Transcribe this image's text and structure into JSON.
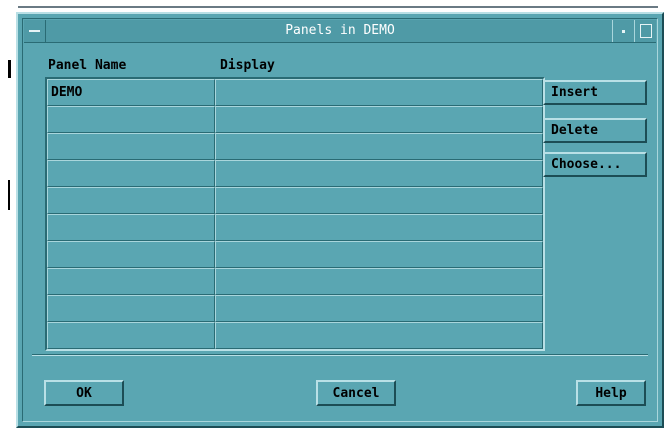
{
  "window": {
    "title": "Panels in DEMO"
  },
  "columns": {
    "name": "Panel Name",
    "display": "Display"
  },
  "rows": [
    {
      "name": "DEMO",
      "display": ""
    },
    {
      "name": "",
      "display": ""
    },
    {
      "name": "",
      "display": ""
    },
    {
      "name": "",
      "display": ""
    },
    {
      "name": "",
      "display": ""
    },
    {
      "name": "",
      "display": ""
    },
    {
      "name": "",
      "display": ""
    },
    {
      "name": "",
      "display": ""
    },
    {
      "name": "",
      "display": ""
    },
    {
      "name": "",
      "display": ""
    }
  ],
  "side_buttons": {
    "insert": "Insert",
    "delete": "Delete",
    "choose": "Choose..."
  },
  "bottom_buttons": {
    "ok": "OK",
    "cancel": "Cancel",
    "help": "Help"
  }
}
